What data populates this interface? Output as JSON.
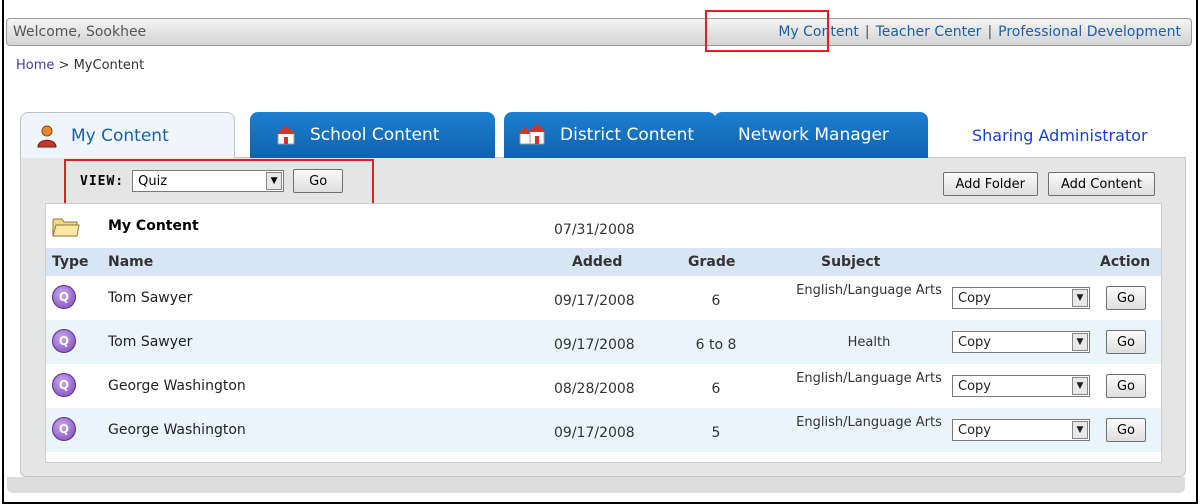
{
  "topbar": {
    "welcome": "Welcome, Sookhee",
    "links": [
      "My Content",
      "Teacher Center",
      "Professional Development"
    ],
    "separator": "|"
  },
  "breadcrumb": {
    "home": "Home",
    "sep": ">",
    "current": "MyContent"
  },
  "tabs": [
    {
      "label": "My Content",
      "icon": "person-icon",
      "active": true
    },
    {
      "label": "School Content",
      "icon": "school-icon",
      "active": false
    },
    {
      "label": "District Content",
      "icon": "district-icon",
      "active": false
    },
    {
      "label": "Network Manager",
      "icon": "",
      "active": false
    },
    {
      "label": "Sharing Administrator",
      "icon": "",
      "active": false
    }
  ],
  "view": {
    "label": "VIEW:",
    "selected": "Quiz",
    "go_label": "Go"
  },
  "actions": {
    "add_folder": "Add Folder",
    "add_content": "Add Content"
  },
  "folder": {
    "name": "My Content",
    "date": "07/31/2008"
  },
  "columns": {
    "type": "Type",
    "name": "Name",
    "added": "Added",
    "grade": "Grade",
    "subject": "Subject",
    "action": "Action"
  },
  "rows": [
    {
      "icon": "Q",
      "name": "Tom Sawyer",
      "added": "09/17/2008",
      "grade": "6",
      "subject": "English/Language Arts",
      "action": "Copy",
      "go": "Go"
    },
    {
      "icon": "Q",
      "name": "Tom Sawyer",
      "added": "09/17/2008",
      "grade": "6 to 8",
      "subject": "Health",
      "action": "Copy",
      "go": "Go"
    },
    {
      "icon": "Q",
      "name": "George Washington",
      "added": "08/28/2008",
      "grade": "6",
      "subject": "English/Language Arts",
      "action": "Copy",
      "go": "Go"
    },
    {
      "icon": "Q",
      "name": "George Washington",
      "added": "09/17/2008",
      "grade": "5",
      "subject": "English/Language Arts",
      "action": "Copy",
      "go": "Go"
    }
  ],
  "colors": {
    "link": "#1a5fa8",
    "tab_blue": "#1470c0",
    "highlight": "#e02020",
    "header_bg": "#d8e5f5",
    "alt_row": "#e9f5fb"
  }
}
